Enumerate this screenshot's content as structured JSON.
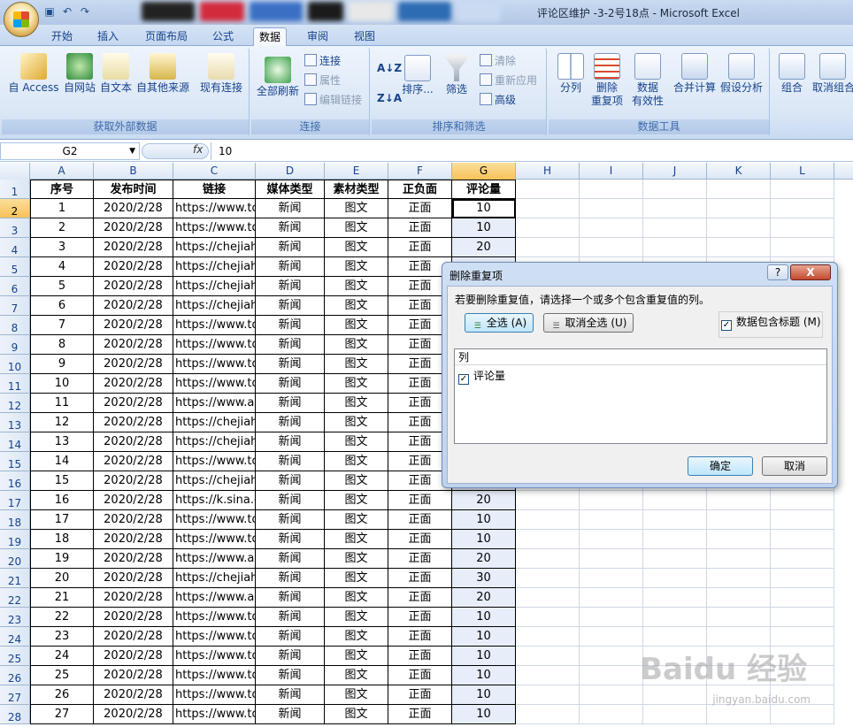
{
  "window": {
    "title": "评论区维护 -3-2号18点 - Microsoft Excel"
  },
  "qat": {
    "save_icon": "save-icon",
    "undo_icon": "undo-icon",
    "redo_icon": "redo-icon"
  },
  "tabs": [
    {
      "label": "开始"
    },
    {
      "label": "插入"
    },
    {
      "label": "页面布局"
    },
    {
      "label": "公式"
    },
    {
      "label": "数据",
      "active": true
    },
    {
      "label": "审阅"
    },
    {
      "label": "视图"
    }
  ],
  "ribbon": {
    "get_external": {
      "label": "获取外部数据",
      "buttons": [
        "自 Access",
        "自网站",
        "自文本",
        "自其他来源",
        "现有连接"
      ]
    },
    "connections": {
      "label": "连接",
      "refresh": "全部刷新",
      "connections": "连接",
      "properties": "属性",
      "edit_links": "编辑链接"
    },
    "sort_filter": {
      "label": "排序和筛选",
      "sort": "排序...",
      "filter": "筛选",
      "clear": "清除",
      "reapply": "重新应用",
      "advanced": "高级"
    },
    "data_tools": {
      "label": "数据工具",
      "split": "分列",
      "remove_dup": "删除",
      "remove_dup2": "重复项",
      "validation": "数据",
      "validation2": "有效性",
      "consolidate": "合并计算",
      "whatif": "假设分析"
    },
    "outline": {
      "group": "组合",
      "ungroup": "取消组合"
    }
  },
  "formula_bar": {
    "name_box": "G2",
    "fx": "fx",
    "value": "10"
  },
  "columns": [
    "A",
    "B",
    "C",
    "D",
    "E",
    "F",
    "G",
    "H",
    "I",
    "J",
    "K",
    "L"
  ],
  "row_numbers": [
    "1",
    "2",
    "3",
    "4",
    "5",
    "6",
    "7",
    "8",
    "9",
    "10",
    "11",
    "12",
    "13",
    "14",
    "15",
    "16",
    "17",
    "18",
    "19",
    "20",
    "21",
    "22",
    "23",
    "24",
    "25",
    "26",
    "27",
    "28"
  ],
  "table": {
    "headers": [
      "序号",
      "发布时间",
      "链接",
      "媒体类型",
      "素材类型",
      "正负面",
      "评论量"
    ],
    "rows": [
      [
        "1",
        "2020/2/28",
        "https://www.to",
        "新闻",
        "图文",
        "正面",
        "10"
      ],
      [
        "2",
        "2020/2/28",
        "https://www.to",
        "新闻",
        "图文",
        "正面",
        "10"
      ],
      [
        "3",
        "2020/2/28",
        "https://chejiah",
        "新闻",
        "图文",
        "正面",
        "20"
      ],
      [
        "4",
        "2020/2/28",
        "https://chejiah",
        "新闻",
        "图文",
        "正面",
        ""
      ],
      [
        "5",
        "2020/2/28",
        "https://chejiah",
        "新闻",
        "图文",
        "正面",
        ""
      ],
      [
        "6",
        "2020/2/28",
        "https://chejiah",
        "新闻",
        "图文",
        "正面",
        ""
      ],
      [
        "7",
        "2020/2/28",
        "https://www.to",
        "新闻",
        "图文",
        "正面",
        ""
      ],
      [
        "8",
        "2020/2/28",
        "https://www.to",
        "新闻",
        "图文",
        "正面",
        ""
      ],
      [
        "9",
        "2020/2/28",
        "https://www.to",
        "新闻",
        "图文",
        "正面",
        ""
      ],
      [
        "10",
        "2020/2/28",
        "https://www.to",
        "新闻",
        "图文",
        "正面",
        ""
      ],
      [
        "11",
        "2020/2/28",
        "https://www.au",
        "新闻",
        "图文",
        "正面",
        ""
      ],
      [
        "12",
        "2020/2/28",
        "https://chejiah",
        "新闻",
        "图文",
        "正面",
        ""
      ],
      [
        "13",
        "2020/2/28",
        "https://chejiah",
        "新闻",
        "图文",
        "正面",
        ""
      ],
      [
        "14",
        "2020/2/28",
        "https://www.to",
        "新闻",
        "图文",
        "正面",
        ""
      ],
      [
        "15",
        "2020/2/28",
        "https://chejiah",
        "新闻",
        "图文",
        "正面",
        ""
      ],
      [
        "16",
        "2020/2/28",
        "https://k.sina.c",
        "新闻",
        "图文",
        "正面",
        "20"
      ],
      [
        "17",
        "2020/2/28",
        "https://www.to",
        "新闻",
        "图文",
        "正面",
        "10"
      ],
      [
        "18",
        "2020/2/28",
        "https://www.to",
        "新闻",
        "图文",
        "正面",
        "10"
      ],
      [
        "19",
        "2020/2/28",
        "https://www.au",
        "新闻",
        "图文",
        "正面",
        "20"
      ],
      [
        "20",
        "2020/2/28",
        "https://chejiah",
        "新闻",
        "图文",
        "正面",
        "30"
      ],
      [
        "21",
        "2020/2/28",
        "https://www.au",
        "新闻",
        "图文",
        "正面",
        "20"
      ],
      [
        "22",
        "2020/2/28",
        "https://www.to",
        "新闻",
        "图文",
        "正面",
        "10"
      ],
      [
        "23",
        "2020/2/28",
        "https://www.to",
        "新闻",
        "图文",
        "正面",
        "10"
      ],
      [
        "24",
        "2020/2/28",
        "https://www.to",
        "新闻",
        "图文",
        "正面",
        "10"
      ],
      [
        "25",
        "2020/2/28",
        "https://www.to",
        "新闻",
        "图文",
        "正面",
        "10"
      ],
      [
        "26",
        "2020/2/28",
        "https://www.to",
        "新闻",
        "图文",
        "正面",
        "10"
      ],
      [
        "27",
        "2020/2/28",
        "https://www.to",
        "新闻",
        "图文",
        "正面",
        "10"
      ]
    ]
  },
  "dialog": {
    "title": "删除重复项",
    "help": "?",
    "close": "X",
    "instruction": "若要删除重复值，请选择一个或多个包含重复值的列。",
    "select_all": "全选 (A)",
    "unselect_all": "取消全选 (U)",
    "has_headers": "数据包含标题 (M)",
    "list_header": "列",
    "columns": [
      "评论量"
    ],
    "ok": "确定",
    "cancel": "取消"
  },
  "watermark": {
    "text": "Baidu 经验",
    "url": "jingyan.baidu.com"
  }
}
